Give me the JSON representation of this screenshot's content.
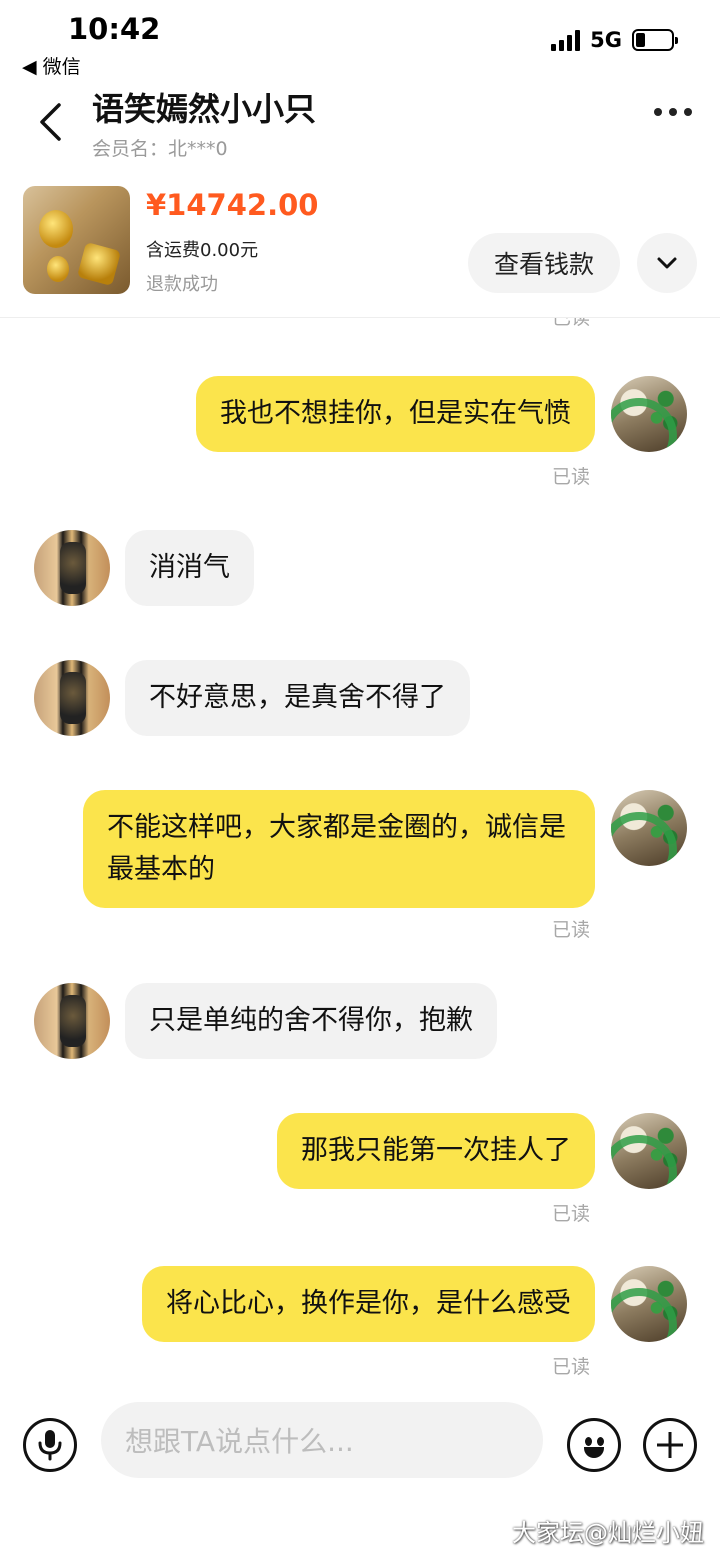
{
  "status_bar": {
    "time": "10:42",
    "back_app": "◀ 微信",
    "network": "5G",
    "battery_level": 0.25
  },
  "header": {
    "title": "语笑嫣然小小只",
    "member_name": "会员名：北***0"
  },
  "order": {
    "price": "¥14742.00",
    "shipping": "含运费0.00元",
    "status": "退款成功",
    "view_payment_label": "查看钱款"
  },
  "messages": [
    {
      "from": "self",
      "text": "我也不想挂你，但是实在气愤",
      "receipt": "已读"
    },
    {
      "from": "other",
      "text": "消消气"
    },
    {
      "from": "other",
      "text": "不好意思，是真舍不得了"
    },
    {
      "from": "self",
      "text": "不能这样吧，大家都是金圈的，诚信是最基本的",
      "receipt": "已读"
    },
    {
      "from": "other",
      "text": "只是单纯的舍不得你，抱歉"
    },
    {
      "from": "self",
      "text": "那我只能第一次挂人了",
      "receipt": "已读"
    },
    {
      "from": "self",
      "text": "将心比心，换作是你，是什么感受",
      "receipt": "已读"
    }
  ],
  "partial_top_receipt": "已读",
  "input": {
    "placeholder": "想跟TA说点什么..."
  },
  "watermark": "大家坛@灿烂小妞",
  "colors": {
    "accent_price": "#ff5a1f",
    "outgoing_bubble": "#fbe44c",
    "incoming_bubble": "#f2f2f2"
  }
}
